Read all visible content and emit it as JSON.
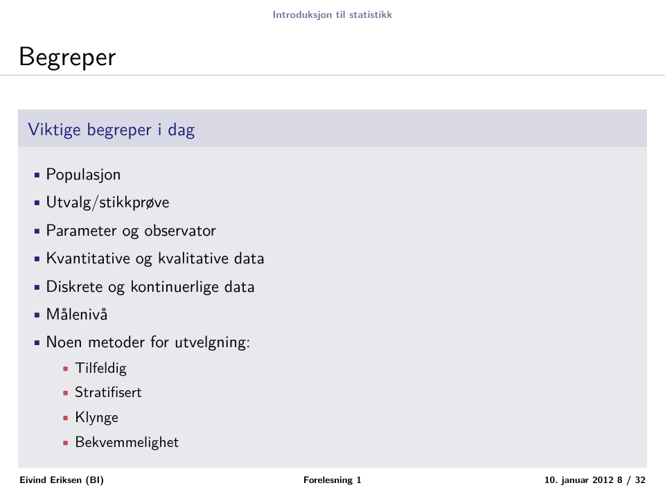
{
  "nav": {
    "section": "Introduksjon til statistikk"
  },
  "frame": {
    "title": "Begreper"
  },
  "block": {
    "title": "Viktige begreper i dag",
    "items": [
      {
        "label": "Populasjon"
      },
      {
        "label": "Utvalg/stikkprøve"
      },
      {
        "label": "Parameter og observator"
      },
      {
        "label": "Kvantitative og kvalitative data"
      },
      {
        "label": "Diskrete og kontinuerlige data"
      },
      {
        "label": "Målenivå"
      },
      {
        "label": "Noen metoder for utvelgning:",
        "sub": [
          "Tilfeldig",
          "Stratifisert",
          "Klynge",
          "Bekvemmelighet"
        ]
      }
    ]
  },
  "footer": {
    "author": "Eivind Eriksen (BI)",
    "title": "Forelesning 1",
    "date_page": "10. januar 2012     8 / 32"
  }
}
